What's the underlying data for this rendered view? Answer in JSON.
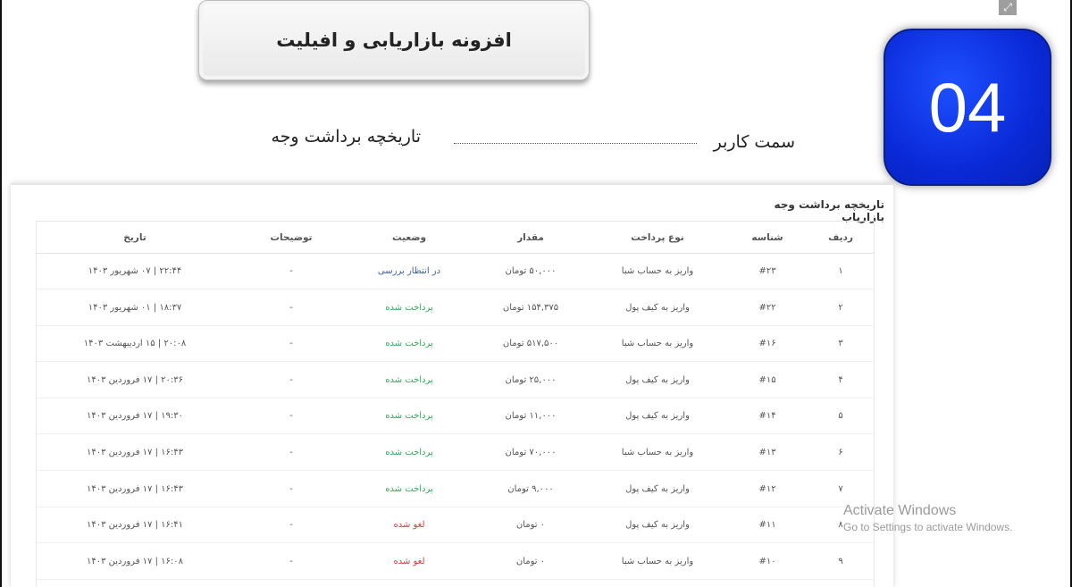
{
  "slide": {
    "title": "افزونه بازاریابی و افیلیت",
    "badge_number": "04",
    "expand_icon": "expand-icon",
    "breadcrumb_right": "سمت کاربر",
    "breadcrumb_left": "تاریخچه برداشت وجه"
  },
  "panel": {
    "title": "تاریخچه برداشت وجه بازاریاب",
    "columns": [
      "ردیف",
      "شناسه",
      "نوع پرداخت",
      "مقدار",
      "وضعیت",
      "توضیحات",
      "تاریخ"
    ],
    "rows": [
      {
        "row": "۱",
        "id": "#۲۳",
        "type": "واریز به حساب شبا",
        "amount": "۵۰,۰۰۰ تومان",
        "status": "در انتظار بررسی",
        "status_kind": "pending",
        "desc": "-",
        "date": "۲۲:۴۴ | ۰۷ شهریور ۱۴۰۳"
      },
      {
        "row": "۲",
        "id": "#۲۲",
        "type": "واریز به کیف پول",
        "amount": "۱۵۴,۳۷۵ تومان",
        "status": "پرداخت شده",
        "status_kind": "paid",
        "desc": "-",
        "date": "۱۸:۳۷ | ۰۱ شهریور ۱۴۰۳"
      },
      {
        "row": "۳",
        "id": "#۱۶",
        "type": "واریز به حساب شبا",
        "amount": "۵۱۷,۵۰۰ تومان",
        "status": "پرداخت شده",
        "status_kind": "paid",
        "desc": "-",
        "date": "۲۰:۰۸ | ۱۵ اردیبهشت ۱۴۰۳"
      },
      {
        "row": "۴",
        "id": "#۱۵",
        "type": "واریز به کیف پول",
        "amount": "۲۵,۰۰۰ تومان",
        "status": "پرداخت شده",
        "status_kind": "paid",
        "desc": "-",
        "date": "۲۰:۳۶ | ۱۷ فروردین ۱۴۰۳"
      },
      {
        "row": "۵",
        "id": "#۱۴",
        "type": "واریز به کیف پول",
        "amount": "۱۱,۰۰۰ تومان",
        "status": "پرداخت شده",
        "status_kind": "paid",
        "desc": "-",
        "date": "۱۹:۳۰ | ۱۷ فروردین ۱۴۰۳"
      },
      {
        "row": "۶",
        "id": "#۱۳",
        "type": "واریز به حساب شبا",
        "amount": "۷۰,۰۰۰ تومان",
        "status": "پرداخت شده",
        "status_kind": "paid",
        "desc": "-",
        "date": "۱۶:۴۳ | ۱۷ فروردین ۱۴۰۳"
      },
      {
        "row": "۷",
        "id": "#۱۲",
        "type": "واریز به کیف پول",
        "amount": "۹,۰۰۰ تومان",
        "status": "پرداخت شده",
        "status_kind": "paid",
        "desc": "-",
        "date": "۱۶:۴۳ | ۱۷ فروردین ۱۴۰۳"
      },
      {
        "row": "۸",
        "id": "#۱۱",
        "type": "واریز به کیف پول",
        "amount": "۰ تومان",
        "status": "لغو شده",
        "status_kind": "canceled",
        "desc": "-",
        "date": "۱۶:۴۱ | ۱۷ فروردین ۱۴۰۳"
      },
      {
        "row": "۹",
        "id": "#۱۰",
        "type": "واریز به حساب شبا",
        "amount": "۰ تومان",
        "status": "لغو شده",
        "status_kind": "canceled",
        "desc": "-",
        "date": "۱۶:۰۸ | ۱۷ فروردین ۱۴۰۳"
      }
    ]
  },
  "colors": {
    "badge_blue": "#0a2ad8",
    "status_pending": "#3b5fa8",
    "status_paid": "#2eaa5a",
    "status_canceled": "#d23b3b"
  },
  "watermark": {
    "line1": "Activate Windows",
    "line2": "Go to Settings to activate Windows."
  }
}
